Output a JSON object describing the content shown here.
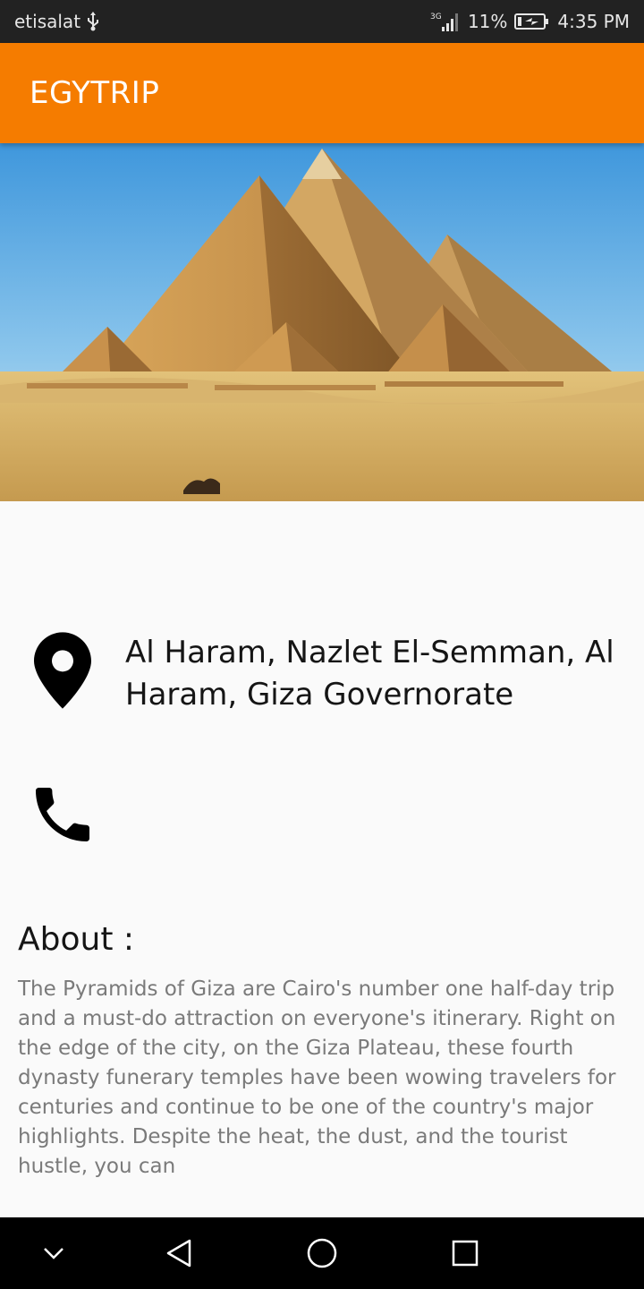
{
  "status_bar": {
    "carrier": "etisalat",
    "network": "3G",
    "battery": "11%",
    "time": "4:35 PM"
  },
  "app_bar": {
    "title": "EGYTRIP"
  },
  "hero_image": {
    "subject": "Pyramids of Giza"
  },
  "place": {
    "address": "Al Haram, Nazlet El-Semman, Al Haram, Giza Governorate",
    "about_heading": "About :",
    "about_text": "The Pyramids of Giza are Cairo's number one half-day trip and a must-do attraction on everyone's itinerary. Right on the edge of the city, on the Giza Plateau, these fourth dynasty funerary temples have been wowing travelers for centuries and continue to be one of the country's major highlights. Despite the heat, the dust, and the tourist hustle, you can"
  },
  "icons": {
    "location": "location-pin-icon",
    "phone": "phone-icon",
    "nav": [
      "collapse-chevron-icon",
      "back-icon",
      "home-icon",
      "recents-icon"
    ]
  },
  "colors": {
    "accent": "#f57c00",
    "status_bar": "#222222",
    "nav_bar": "#000000"
  }
}
